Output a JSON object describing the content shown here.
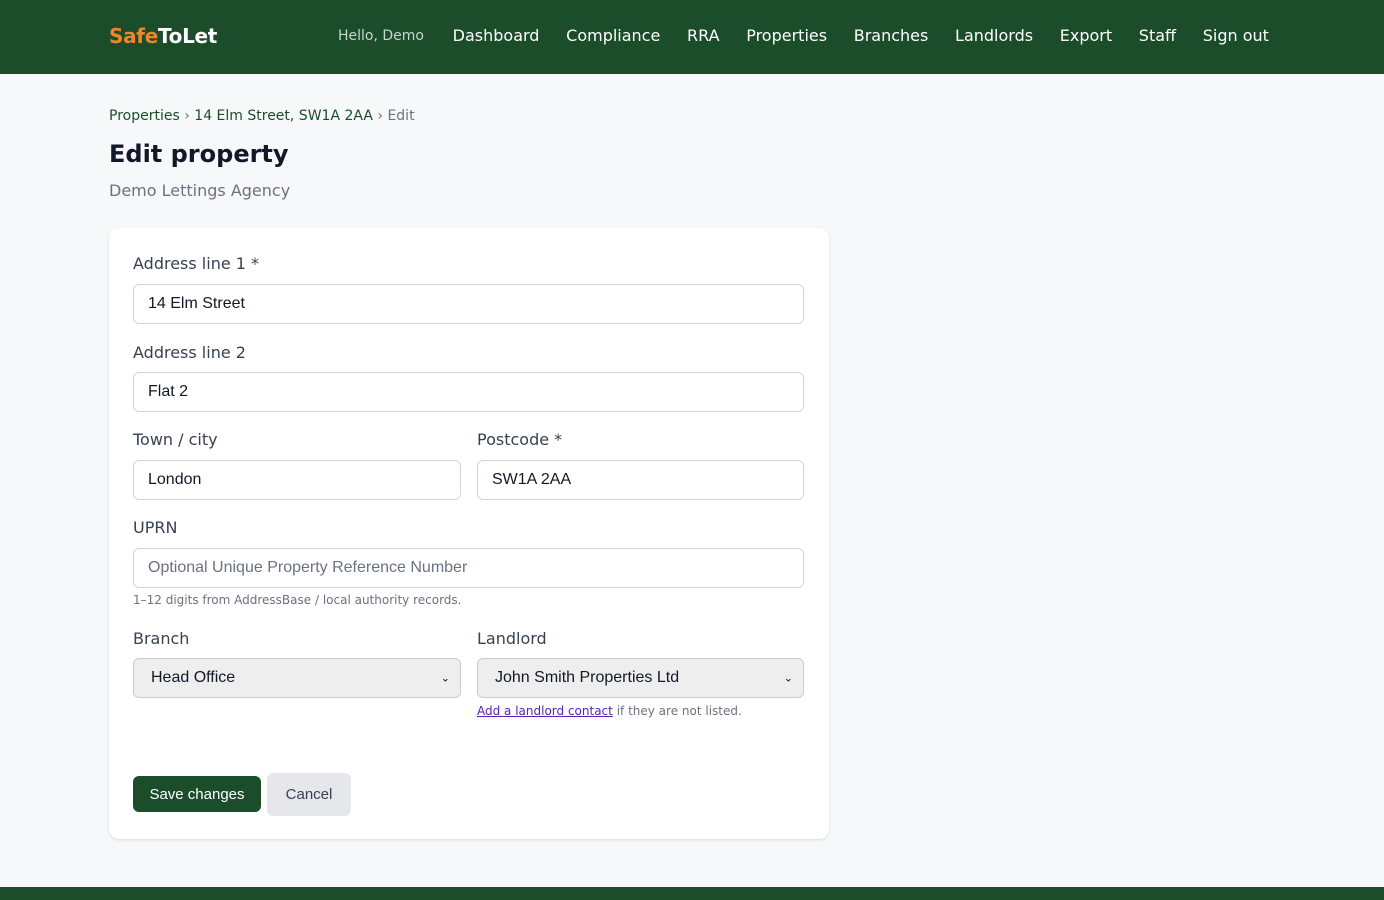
{
  "brand": {
    "part1": "Safe",
    "part2": "ToLet"
  },
  "nav": {
    "greeting": "Hello, Demo",
    "links": [
      "Dashboard",
      "Compliance",
      "RRA",
      "Properties",
      "Branches",
      "Landlords",
      "Export",
      "Staff",
      "Sign out"
    ]
  },
  "breadcrumb": {
    "items": [
      "Properties",
      "14 Elm Street, SW1A 2AA"
    ],
    "separator": "›",
    "current": "Edit"
  },
  "page": {
    "title": "Edit property",
    "subtitle": "Demo Lettings Agency"
  },
  "form": {
    "address1": {
      "label": "Address line 1 *",
      "value": "14 Elm Street"
    },
    "address2": {
      "label": "Address line 2",
      "value": "Flat 2"
    },
    "town": {
      "label": "Town / city",
      "value": "London"
    },
    "postcode": {
      "label": "Postcode *",
      "value": "SW1A 2AA"
    },
    "uprn": {
      "label": "UPRN",
      "value": "",
      "placeholder": "Optional Unique Property Reference Number",
      "hint": "1–12 digits from AddressBase / local authority records."
    },
    "branch": {
      "label": "Branch",
      "selected": "Head Office"
    },
    "landlord": {
      "label": "Landlord",
      "selected": "John Smith Properties Ltd",
      "hint_link": "Add a landlord contact",
      "hint_rest": " if they are not listed."
    },
    "save_label": "Save changes",
    "cancel_label": "Cancel"
  },
  "colors": {
    "header_bg": "#1b4d2b",
    "brand_accent": "#f0862a",
    "primary_button": "#1b4d2b",
    "link_visited": "#5b21b6"
  }
}
